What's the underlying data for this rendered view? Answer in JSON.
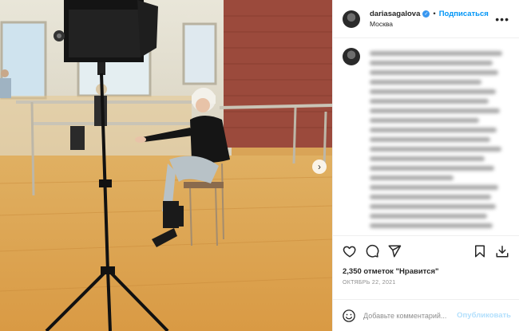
{
  "header": {
    "username": "dariasagalova",
    "verified": true,
    "separator": "•",
    "follow_label": "Подписаться",
    "location": "Москва",
    "more_label": "•••"
  },
  "icons": {
    "like": "heart-icon",
    "comment": "comment-icon",
    "share": "share-icon",
    "save": "bookmark-icon",
    "save_alt": "download-icon",
    "emoji": "emoji-icon",
    "next": "chevron-right-icon"
  },
  "post": {
    "likes_text": "2,350 отметок \"Нравится\"",
    "date_text": "ОКТЯБРЬ 22, 2021"
  },
  "comment_box": {
    "placeholder": "Добавьте комментарий...",
    "publish_label": "Опубликовать"
  },
  "colors": {
    "accent": "#0095f6",
    "publish_disabled": "#b2dffc",
    "verified": "#3897f0"
  }
}
